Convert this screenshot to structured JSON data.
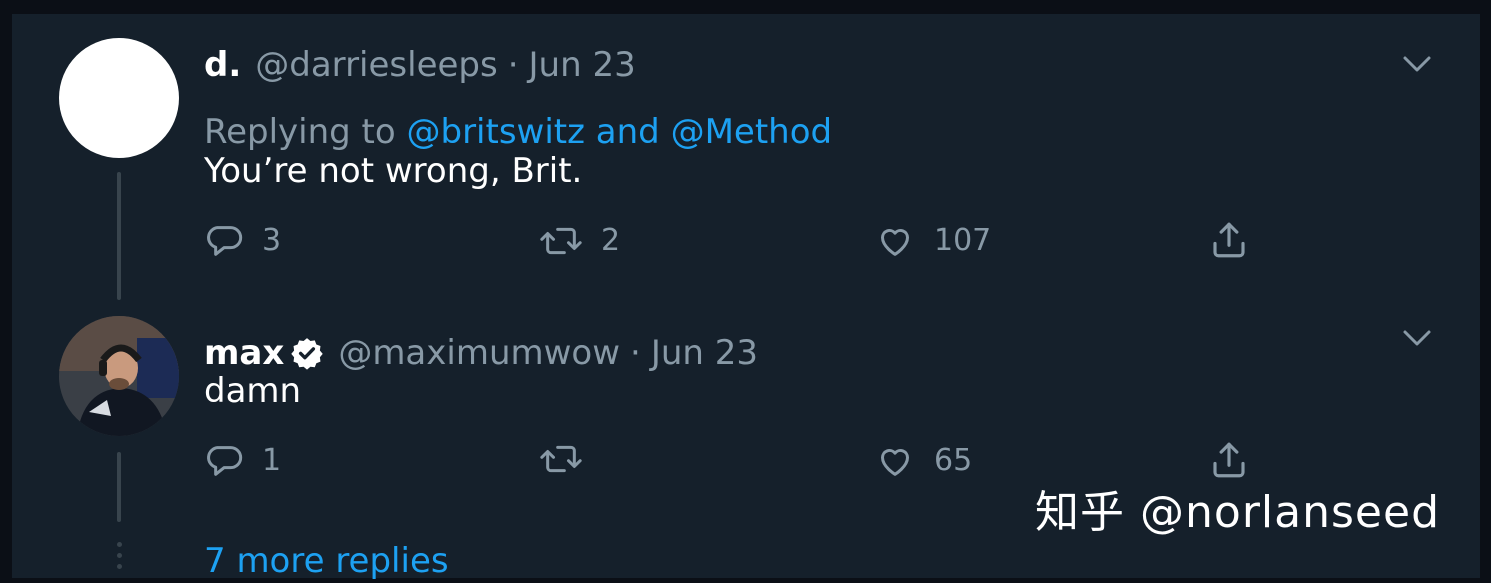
{
  "tweets": [
    {
      "name": "d.",
      "handle": "@darriesleeps",
      "separator": "·",
      "date": "Jun 23",
      "replying_prefix": "Replying to",
      "replying_to": "@britswitz and @Method",
      "text": "You’re not wrong, Brit.",
      "replies": "3",
      "retweets": "2",
      "likes": "107",
      "avatar": "blank-white-avatar",
      "verified": false
    },
    {
      "name": "max",
      "handle": "@maximumwow",
      "separator": "·",
      "date": "Jun 23",
      "text": "damn",
      "replies": "1",
      "retweets": "",
      "likes": "65",
      "avatar": "photo-avatar",
      "verified": true
    }
  ],
  "more_replies": "7 more replies",
  "watermark": "知乎 @norlanseed",
  "colors": {
    "background": "#15202b",
    "text": "#ffffff",
    "secondary": "#8899a6",
    "accent": "#1da1f2"
  },
  "icons": [
    "reply-icon",
    "retweet-icon",
    "like-icon",
    "share-icon",
    "chevron-down-icon",
    "verified-badge-icon"
  ]
}
